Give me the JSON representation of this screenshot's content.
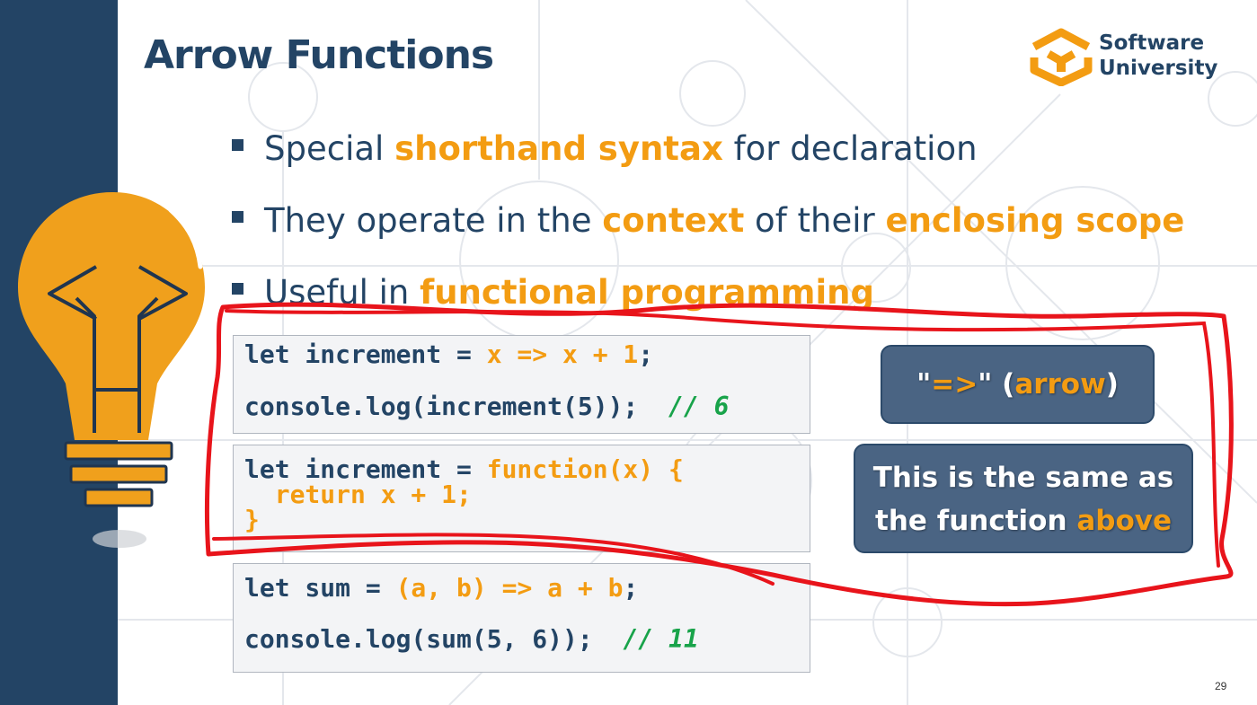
{
  "slide": {
    "title": "Arrow Functions",
    "page_number": "29"
  },
  "logo": {
    "line1": "Software",
    "line2": "University",
    "color": "#f39c12"
  },
  "bullets": [
    {
      "pre": "Special ",
      "hl": "shorthand syntax",
      "post": " for declaration"
    },
    {
      "pre": "They operate in the ",
      "hl": "context",
      "mid": " of their ",
      "hl2": "enclosing scope"
    },
    {
      "pre": "Useful in ",
      "hl": "functional programming"
    }
  ],
  "code_blocks": [
    {
      "line1": {
        "a": "let increment = ",
        "b": "x => x + 1",
        "c": ";"
      },
      "line2": {
        "a": "console.log(increment(5));  ",
        "comment": "// 6"
      }
    },
    {
      "line1": {
        "a": "let increment = ",
        "b": "function(x) {"
      },
      "line2": {
        "b": "  return x + 1;"
      },
      "line3": {
        "b": "}"
      }
    },
    {
      "line1": {
        "a": "let sum = ",
        "b": "(a, b) => a + b",
        "c": ";"
      },
      "line2": {
        "a": "console.log(sum(5, 6));  ",
        "comment": "// 11"
      }
    }
  ],
  "callouts": {
    "arrow": {
      "q1": "\"",
      "sym": "=>",
      "q2": "\" (",
      "word": "arrow",
      "close": ")"
    },
    "same": {
      "line1": "This is the same as",
      "line2_pre": "the function ",
      "line2_hl": "above"
    }
  },
  "colors": {
    "navy": "#234465",
    "accent": "#f39c12",
    "comment": "#18a34a",
    "annotation": "#e8141b"
  },
  "icons": [
    "lightbulb-code-icon",
    "software-university-logo-icon"
  ]
}
